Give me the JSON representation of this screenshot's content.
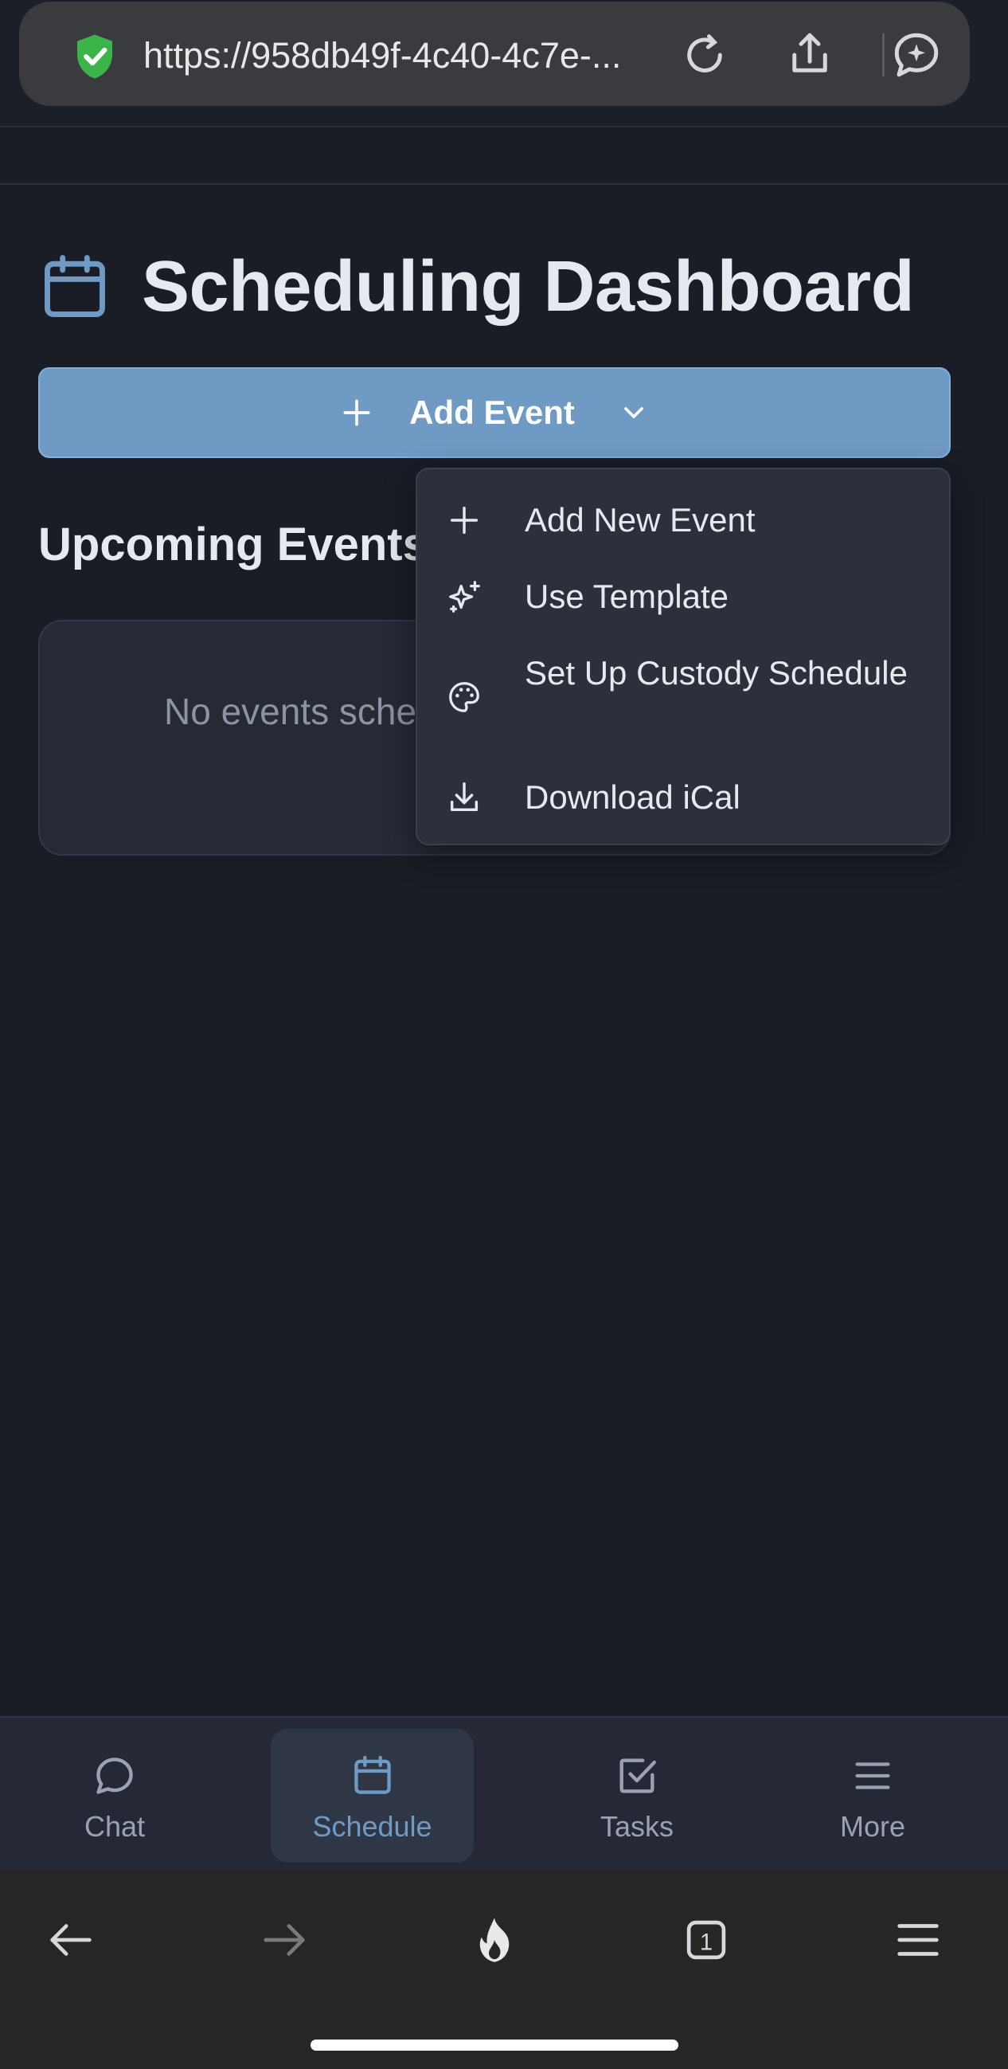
{
  "browser": {
    "url": "https://958db49f-4c40-4c7e-...",
    "tab_count": "1"
  },
  "header": {
    "title": "Scheduling Dashboard",
    "add_event_label": "Add Event"
  },
  "upcoming": {
    "title": "Upcoming Events",
    "empty_text": "No events scheduled"
  },
  "dropdown": {
    "items": [
      {
        "label": "Add New Event",
        "icon": "plus-icon"
      },
      {
        "label": "Use Template",
        "icon": "sparkles-icon"
      },
      {
        "label": "Set Up Custody Schedule",
        "icon": "palette-icon"
      },
      {
        "label": "Download iCal",
        "icon": "download-icon"
      }
    ]
  },
  "nav": {
    "items": [
      {
        "label": "Chat",
        "icon": "chat-icon"
      },
      {
        "label": "Schedule",
        "icon": "calendar-icon",
        "active": true
      },
      {
        "label": "Tasks",
        "icon": "checkbox-icon"
      },
      {
        "label": "More",
        "icon": "menu-icon"
      }
    ]
  },
  "colors": {
    "background": "#1a1d26",
    "accent": "#6f9ac4",
    "card": "#262a35",
    "menu": "#2c303b"
  }
}
